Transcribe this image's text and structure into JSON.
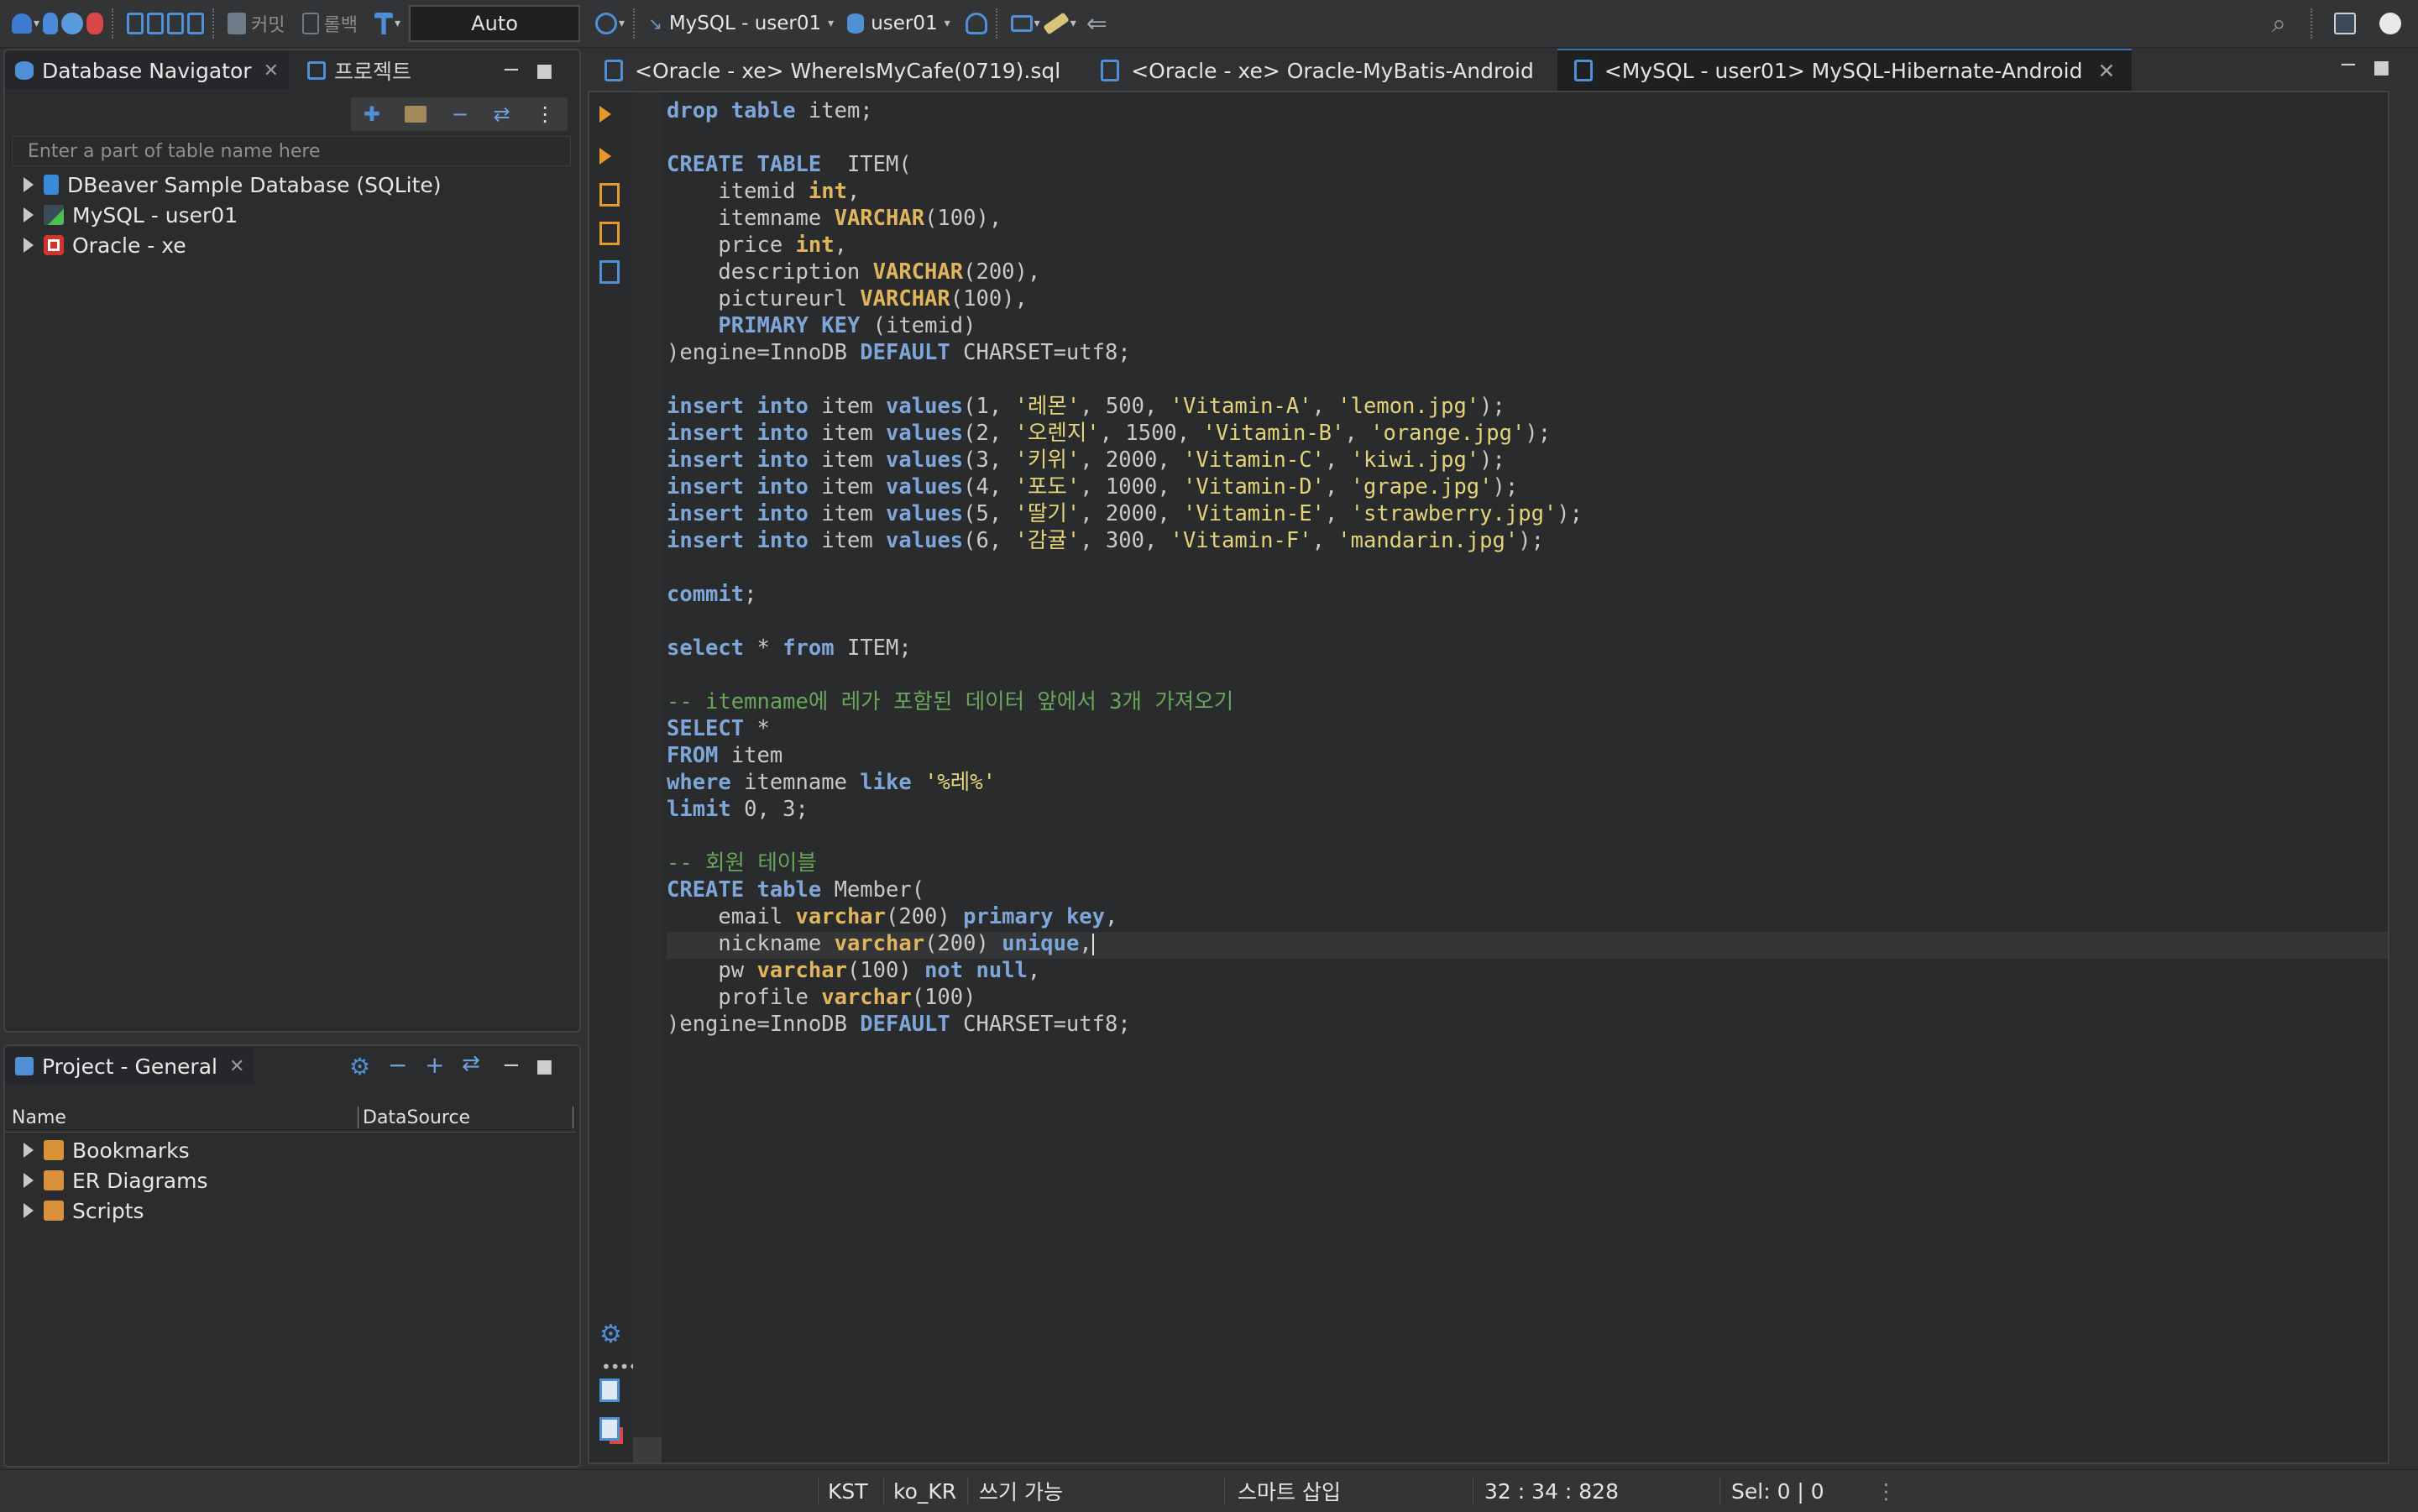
{
  "toolbar": {
    "commit_label": "커밋",
    "rollback_label": "롤백",
    "transaction_mode": "Auto",
    "datasource": "MySQL - user01",
    "schema": "user01"
  },
  "db_navigator": {
    "tab_label": "Database Navigator",
    "projects_tab_label": "프로젝트",
    "filter_placeholder": "Enter a part of table name here",
    "items": [
      {
        "label": "DBeaver Sample Database (SQLite)"
      },
      {
        "label": "MySQL - user01"
      },
      {
        "label": "Oracle - xe"
      }
    ]
  },
  "project_panel": {
    "tab_label": "Project - General",
    "columns": [
      "Name",
      "DataSource"
    ],
    "items": [
      {
        "label": "Bookmarks"
      },
      {
        "label": "ER Diagrams"
      },
      {
        "label": "Scripts"
      }
    ]
  },
  "editor": {
    "tabs": [
      {
        "label": "<Oracle - xe> WhereIsMyCafe(0719).sql",
        "active": false
      },
      {
        "label": "<Oracle - xe> Oracle-MyBatis-Android",
        "active": false
      },
      {
        "label": "<MySQL - user01> MySQL-Hibernate-Android",
        "active": true
      }
    ],
    "lines": [
      "drop table item;",
      "",
      "CREATE TABLE  ITEM(",
      "    itemid int,",
      "    itemname VARCHAR(100),",
      "    price int,",
      "    description VARCHAR(200),",
      "    pictureurl VARCHAR(100),",
      "    PRIMARY KEY (itemid)",
      ")engine=InnoDB DEFAULT CHARSET=utf8;",
      "",
      "insert into item values(1, '레몬', 500, 'Vitamin-A', 'lemon.jpg');",
      "insert into item values(2, '오렌지', 1500, 'Vitamin-B', 'orange.jpg');",
      "insert into item values(3, '키위', 2000, 'Vitamin-C', 'kiwi.jpg');",
      "insert into item values(4, '포도', 1000, 'Vitamin-D', 'grape.jpg');",
      "insert into item values(5, '딸기', 2000, 'Vitamin-E', 'strawberry.jpg');",
      "insert into item values(6, '감귤', 300, 'Vitamin-F', 'mandarin.jpg');",
      "",
      "commit;",
      "",
      "select * from ITEM;",
      "",
      "-- itemname에 레가 포함된 데이터 앞에서 3개 가져오기",
      "SELECT *",
      "FROM item",
      "where itemname like '%레%'",
      "limit 0, 3;",
      "",
      "-- 회원 테이블",
      "CREATE table Member(",
      "    email varchar(200) primary key,",
      "    nickname varchar(200) unique,",
      "    pw varchar(100) not null,",
      "    profile varchar(100)",
      ")engine=InnoDB DEFAULT CHARSET=utf8;"
    ],
    "current_line_index": 31
  },
  "status_bar": {
    "timezone": "KST",
    "locale": "ko_KR",
    "writable": "쓰기 가능",
    "insert_mode": "스마트 삽입",
    "cursor": "32 : 34 : 828",
    "selection": "Sel: 0 | 0"
  },
  "colors": {
    "keyword": "#7fa6d9",
    "type": "#e0b55c",
    "string": "#e3d47b",
    "comment": "#69a55a",
    "accent": "#4f8fd6"
  }
}
